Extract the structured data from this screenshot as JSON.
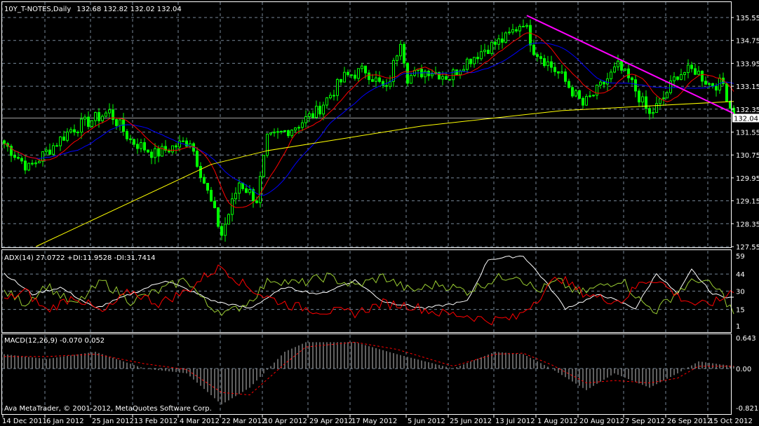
{
  "window": {
    "symbol_title": "10Y_T-NOTES,Daily",
    "ohlc": "132.68 132.82 132.02 132.04",
    "copyright": "Ava MetaTrader, © 2001-2012, MetaQuotes Software Corp."
  },
  "colors": {
    "background": "#000000",
    "candle": "#00ff00",
    "ma_fast": "#ff0000",
    "ma_slow": "#0000ff",
    "ma_200": "#ffff00",
    "trendline": "#ff00ff",
    "adx": "#ffffff",
    "plus_di": "#9acd32",
    "minus_di": "#ff0000",
    "macd_hist": "#c0c0c0",
    "macd_signal": "#ff0000",
    "grid": "#778899"
  },
  "chart_data": [
    {
      "type": "candlestick",
      "title": "10Y_T-NOTES,Daily",
      "bar_count": 209,
      "x_tick_labels": [
        "14 Dec 2011",
        "6 Jan 2012",
        "25 Jan 2012",
        "13 Feb 2012",
        "4 Mar 2012",
        "22 Mar 2012",
        "10 Apr 2012",
        "29 Apr 2012",
        "17 May 2012",
        "5 Jun 2012",
        "25 Jun 2012",
        "13 Jul 2012",
        "1 Aug 2012",
        "20 Aug 2012",
        "7 Sep 2012",
        "26 Sep 2012",
        "15 Oct 2012"
      ],
      "x_tick_bars": [
        0,
        12,
        25,
        37,
        50,
        62,
        74,
        87,
        99,
        115,
        127,
        140,
        152,
        164,
        177,
        189,
        201
      ],
      "y_tick_labels": [
        "135.55",
        "134.75",
        "133.95",
        "133.15",
        "132.35",
        "131.55",
        "130.75",
        "129.95",
        "129.15",
        "128.35",
        "127.55"
      ],
      "ylim": [
        127.55,
        135.55
      ],
      "current_price": "132.04",
      "close_keypoints": [
        [
          0,
          131.15
        ],
        [
          7,
          130.29
        ],
        [
          19,
          131.64
        ],
        [
          30,
          132.25
        ],
        [
          36,
          131.27
        ],
        [
          43,
          130.78
        ],
        [
          53,
          131.27
        ],
        [
          59,
          129.07
        ],
        [
          62,
          127.97
        ],
        [
          67,
          129.8
        ],
        [
          72,
          129.19
        ],
        [
          75,
          131.27
        ],
        [
          83,
          131.76
        ],
        [
          89,
          132.25
        ],
        [
          97,
          133.47
        ],
        [
          103,
          133.72
        ],
        [
          109,
          132.98
        ],
        [
          113,
          134.82
        ],
        [
          115,
          133.47
        ],
        [
          121,
          133.72
        ],
        [
          127,
          133.47
        ],
        [
          131,
          133.96
        ],
        [
          137,
          134.45
        ],
        [
          143,
          134.82
        ],
        [
          148,
          135.43
        ],
        [
          151,
          134.45
        ],
        [
          155,
          133.96
        ],
        [
          159,
          133.47
        ],
        [
          165,
          132.49
        ],
        [
          169,
          132.98
        ],
        [
          175,
          133.84
        ],
        [
          179,
          133.23
        ],
        [
          184,
          132.13
        ],
        [
          188,
          132.74
        ],
        [
          192,
          133.59
        ],
        [
          197,
          133.72
        ],
        [
          201,
          133.23
        ],
        [
          205,
          133.23
        ],
        [
          208,
          132.04
        ]
      ],
      "ma200_keypoints": [
        [
          9,
          127.55
        ],
        [
          59,
          130.42
        ],
        [
          75,
          130.9
        ],
        [
          119,
          131.76
        ],
        [
          159,
          132.3
        ],
        [
          208,
          132.62
        ]
      ],
      "trendline": [
        [
          149,
          135.62
        ],
        [
          208,
          132.2
        ]
      ]
    },
    {
      "type": "line",
      "title": "ADX(14) 27.0722 +DI:11.9528 -DI:31.7414",
      "y_tick_labels": [
        "59",
        "44",
        "30",
        "15",
        "1"
      ],
      "ylim": [
        1,
        59
      ],
      "series": [
        {
          "name": "ADX",
          "keypoints": [
            [
              0,
              44.6
            ],
            [
              8,
              27.4
            ],
            [
              16,
              33.1
            ],
            [
              26,
              15.9
            ],
            [
              36,
              27.4
            ],
            [
              46,
              38.9
            ],
            [
              60,
              21.6
            ],
            [
              70,
              15.9
            ],
            [
              80,
              33.1
            ],
            [
              90,
              27.4
            ],
            [
              100,
              38.9
            ],
            [
              108,
              21.6
            ],
            [
              120,
              15.9
            ],
            [
              132,
              21.6
            ],
            [
              138,
              56.1
            ],
            [
              148,
              59
            ],
            [
              154,
              38.9
            ],
            [
              160,
              15.9
            ],
            [
              170,
              27.4
            ],
            [
              180,
              15.9
            ],
            [
              186,
              44.6
            ],
            [
              192,
              27.4
            ],
            [
              196,
              47.5
            ],
            [
              202,
              27.4
            ],
            [
              208,
              24.5
            ]
          ]
        },
        {
          "name": "+DI",
          "keypoints": [
            [
              0,
              30
            ],
            [
              6,
              20
            ],
            [
              12,
              35
            ],
            [
              20,
              18
            ],
            [
              28,
              38
            ],
            [
              36,
              22
            ],
            [
              44,
              30
            ],
            [
              52,
              40
            ],
            [
              58,
              18
            ],
            [
              64,
              12
            ],
            [
              70,
              22
            ],
            [
              76,
              40
            ],
            [
              84,
              36
            ],
            [
              92,
              42
            ],
            [
              100,
              34
            ],
            [
              108,
              42
            ],
            [
              116,
              30
            ],
            [
              124,
              36
            ],
            [
              132,
              30
            ],
            [
              140,
              40
            ],
            [
              146,
              44
            ],
            [
              152,
              30
            ],
            [
              158,
              38
            ],
            [
              164,
              28
            ],
            [
              170,
              34
            ],
            [
              176,
              40
            ],
            [
              182,
              20
            ],
            [
              186,
              14
            ],
            [
              192,
              30
            ],
            [
              198,
              40
            ],
            [
              204,
              30
            ],
            [
              208,
              12
            ]
          ]
        },
        {
          "name": "-DI",
          "keypoints": [
            [
              0,
              22
            ],
            [
              6,
              30
            ],
            [
              12,
              14
            ],
            [
              20,
              26
            ],
            [
              28,
              12
            ],
            [
              36,
              30
            ],
            [
              44,
              20
            ],
            [
              52,
              30
            ],
            [
              58,
              44
            ],
            [
              62,
              50
            ],
            [
              68,
              36
            ],
            [
              74,
              26
            ],
            [
              82,
              18
            ],
            [
              90,
              14
            ],
            [
              100,
              12
            ],
            [
              108,
              20
            ],
            [
              116,
              18
            ],
            [
              124,
              12
            ],
            [
              132,
              10
            ],
            [
              138,
              6
            ],
            [
              146,
              8
            ],
            [
              152,
              24
            ],
            [
              158,
              42
            ],
            [
              164,
              30
            ],
            [
              170,
              24
            ],
            [
              176,
              22
            ],
            [
              182,
              38
            ],
            [
              186,
              40
            ],
            [
              192,
              26
            ],
            [
              198,
              18
            ],
            [
              204,
              22
            ],
            [
              208,
              32
            ]
          ]
        }
      ]
    },
    {
      "type": "bar+line",
      "title": "MACD(12,26,9) -0.070 0.052",
      "y_tick_labels": [
        "0.643",
        "0.00",
        "-0.821"
      ],
      "ylim": [
        -0.821,
        0.643
      ],
      "series": [
        {
          "name": "MACD",
          "keypoints": [
            [
              0,
              0.3
            ],
            [
              12,
              0.2
            ],
            [
              26,
              0.35
            ],
            [
              40,
              0.0
            ],
            [
              52,
              -0.1
            ],
            [
              62,
              -0.75
            ],
            [
              70,
              -0.4
            ],
            [
              80,
              0.35
            ],
            [
              86,
              0.55
            ],
            [
              100,
              0.55
            ],
            [
              112,
              0.3
            ],
            [
              128,
              0.0
            ],
            [
              140,
              0.35
            ],
            [
              148,
              0.3
            ],
            [
              156,
              0.0
            ],
            [
              166,
              -0.45
            ],
            [
              174,
              -0.1
            ],
            [
              184,
              -0.4
            ],
            [
              192,
              -0.1
            ],
            [
              198,
              0.15
            ],
            [
              208,
              0.05
            ]
          ]
        },
        {
          "name": "Signal",
          "keypoints": [
            [
              0,
              0.25
            ],
            [
              12,
              0.25
            ],
            [
              26,
              0.3
            ],
            [
              40,
              0.1
            ],
            [
              52,
              -0.02
            ],
            [
              62,
              -0.5
            ],
            [
              70,
              -0.55
            ],
            [
              80,
              0.1
            ],
            [
              86,
              0.45
            ],
            [
              100,
              0.55
            ],
            [
              112,
              0.4
            ],
            [
              128,
              0.05
            ],
            [
              140,
              0.3
            ],
            [
              148,
              0.32
            ],
            [
              156,
              0.08
            ],
            [
              166,
              -0.3
            ],
            [
              174,
              -0.25
            ],
            [
              184,
              -0.3
            ],
            [
              192,
              -0.2
            ],
            [
              198,
              0.05
            ],
            [
              208,
              0.05
            ]
          ]
        }
      ]
    }
  ]
}
